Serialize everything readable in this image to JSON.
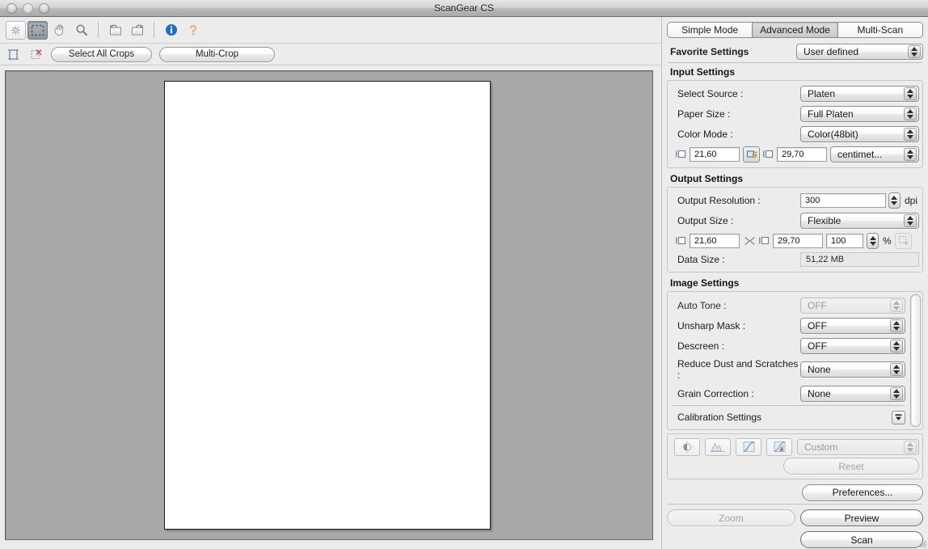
{
  "window": {
    "title": "ScanGear CS",
    "traffic_lights": [
      "close",
      "minimize",
      "zoom"
    ]
  },
  "toolbar": {
    "items": [
      {
        "name": "auto-crop-icon",
        "label": "Auto Crop",
        "state": "framed"
      },
      {
        "name": "crop-select-icon",
        "label": "Crop",
        "state": "active"
      },
      {
        "name": "hand-tool-icon",
        "label": "Move Image",
        "state": "plain"
      },
      {
        "name": "zoom-tool-icon",
        "label": "Zoom",
        "state": "plain"
      },
      {
        "name": "rotate-left-icon",
        "label": "Rotate Left",
        "state": "plain"
      },
      {
        "name": "rotate-right-icon",
        "label": "Rotate Right",
        "state": "plain"
      },
      {
        "name": "info-icon",
        "label": "Information",
        "state": "plain"
      },
      {
        "name": "help-icon",
        "label": "Help",
        "state": "plain"
      }
    ]
  },
  "cropbar": {
    "select_frame_icon": "select-frame-icon",
    "remove_frame_icon": "remove-frame-icon",
    "select_all_crops": "Select All Crops",
    "multi_crop": "Multi-Crop"
  },
  "preview": {
    "background_color": "#a8a8a8",
    "sheet_color": "#ffffff"
  },
  "tabs": [
    {
      "label": "Simple Mode",
      "selected": false
    },
    {
      "label": "Advanced Mode",
      "selected": true
    },
    {
      "label": "Multi-Scan",
      "selected": false
    }
  ],
  "favorite": {
    "label": "Favorite Settings",
    "value": "User defined"
  },
  "input_settings": {
    "heading": "Input Settings",
    "select_source": {
      "label": "Select Source :",
      "value": "Platen"
    },
    "paper_size": {
      "label": "Paper Size :",
      "value": "Full Platen"
    },
    "color_mode": {
      "label": "Color Mode :",
      "value": "Color(48bit)"
    },
    "width": "21,60",
    "height": "29,70",
    "unit": "centimet...",
    "lock_icon": "link-lock-icon",
    "width_icon": "width-icon",
    "height_icon": "height-icon"
  },
  "output_settings": {
    "heading": "Output Settings",
    "resolution": {
      "label": "Output Resolution :",
      "value": "300",
      "unit": "dpi"
    },
    "output_size": {
      "label": "Output Size :",
      "value": "Flexible"
    },
    "width": "21,60",
    "height": "29,70",
    "scale": "100",
    "scale_unit": "%",
    "chain_icon": "chain-broken-icon",
    "keep-ratio_icon": "crop-lock-icon",
    "data_size": {
      "label": "Data Size :",
      "value": "51,22 MB"
    }
  },
  "image_settings": {
    "heading": "Image Settings",
    "rows": [
      {
        "label": "Auto Tone :",
        "value": "OFF",
        "disabled": true
      },
      {
        "label": "Unsharp Mask :",
        "value": "OFF",
        "disabled": false
      },
      {
        "label": "Descreen :",
        "value": "OFF",
        "disabled": false
      },
      {
        "label": "Reduce Dust and Scratches :",
        "value": "None",
        "disabled": false
      },
      {
        "label": "Grain Correction :",
        "value": "None",
        "disabled": false
      }
    ],
    "calibration": {
      "label": "Calibration Settings",
      "disclosure_icon": "disclosure-triangle-icon"
    }
  },
  "adjust_tools": {
    "icons": [
      {
        "name": "brightness-contrast-icon",
        "label": "Brightness/Contrast"
      },
      {
        "name": "histogram-icon",
        "label": "Histogram"
      },
      {
        "name": "tone-curve-icon",
        "label": "Tone Curve"
      },
      {
        "name": "final-review-icon",
        "label": "Final Review"
      }
    ],
    "preset": "Custom",
    "reset": "Reset"
  },
  "actions": {
    "preferences": "Preferences...",
    "zoom": "Zoom",
    "preview": "Preview",
    "scan": "Scan"
  },
  "colors": {
    "window_bg": "#ececec",
    "preview_bg": "#a8a8a8",
    "accent_blue": "#1f6fc4",
    "text": "#1b1b1b",
    "disabled_text": "#a3a3a3"
  }
}
